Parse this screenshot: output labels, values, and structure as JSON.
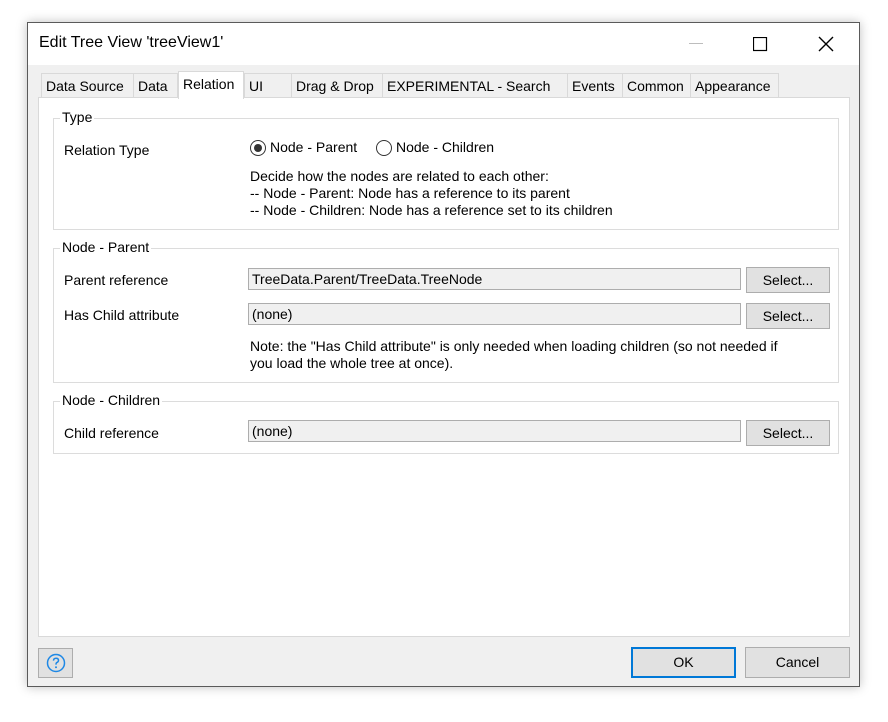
{
  "window": {
    "title": "Edit Tree View 'treeView1'"
  },
  "tabs": [
    {
      "label": "Data Source"
    },
    {
      "label": "Data"
    },
    {
      "label": "Relation"
    },
    {
      "label": "UI"
    },
    {
      "label": "Drag & Drop"
    },
    {
      "label": "EXPERIMENTAL - Search"
    },
    {
      "label": "Events"
    },
    {
      "label": "Common"
    },
    {
      "label": "Appearance"
    }
  ],
  "active_tab": "Relation",
  "type_group": {
    "title": "Type",
    "relation_type_label": "Relation Type",
    "options": [
      {
        "label": "Node - Parent",
        "checked": true
      },
      {
        "label": "Node - Children",
        "checked": false
      }
    ],
    "description": [
      "Decide how the nodes are related to each other:",
      "-- Node - Parent: Node has a reference to its parent",
      "-- Node - Children: Node has a reference set to its children"
    ]
  },
  "parent_group": {
    "title": "Node - Parent",
    "parent_reference_label": "Parent reference",
    "parent_reference_value": "TreeData.Parent/TreeData.TreeNode",
    "has_child_label": "Has Child attribute",
    "has_child_value": "(none)",
    "note_line1": "Note: the \"Has Child attribute\" is only needed when loading children (so not needed if",
    "note_line2": "you load the whole tree at once)."
  },
  "children_group": {
    "title": "Node - Children",
    "child_reference_label": "Child reference",
    "child_reference_value": "(none)"
  },
  "select_button_label": "Select...",
  "footer": {
    "ok_label": "OK",
    "cancel_label": "Cancel"
  },
  "icons": {
    "help": "help-icon",
    "minimize": "minimize-icon",
    "maximize": "maximize-icon",
    "close": "close-icon"
  }
}
